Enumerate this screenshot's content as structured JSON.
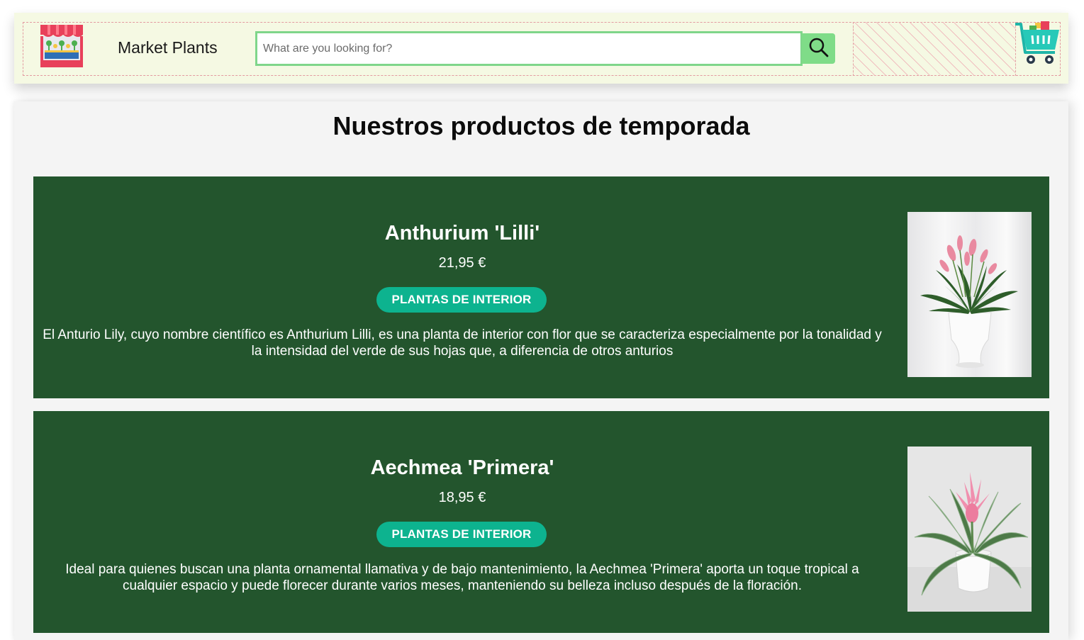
{
  "header": {
    "brand": "Market Plants",
    "search_placeholder": "What are you looking for?",
    "search_value": ""
  },
  "main": {
    "title": "Nuestros productos de temporada",
    "products": [
      {
        "name": "Anthurium 'Lilli'",
        "price": "21,95 €",
        "category": "PLANTAS DE INTERIOR",
        "description": "El Anturio Lily, cuyo nombre científico es Anthurium Lilli, es una planta de interior con flor que se caracteriza especialmente por la tonalidad y la intensidad del verde de sus hojas que, a diferencia de otros anturios"
      },
      {
        "name": "Aechmea 'Primera'",
        "price": "18,95 €",
        "category": "PLANTAS DE INTERIOR",
        "description": "Ideal para quienes buscan una planta ornamental llamativa y de bajo mantenimiento, la Aechmea 'Primera' aporta un toque tropical a cualquier espacio y puede florecer durante varios meses, manteniendo su belleza incluso después de la floración."
      }
    ]
  },
  "icons": {
    "logo": "market-stall-icon",
    "search": "search-icon",
    "cart": "shopping-cart-icon"
  },
  "colors": {
    "header_bg": "#f5f9e3",
    "card_bg": "#23552d",
    "accent_green": "#7fdc88",
    "category_badge": "#0db38f",
    "dashed_border": "#e39aa0"
  }
}
